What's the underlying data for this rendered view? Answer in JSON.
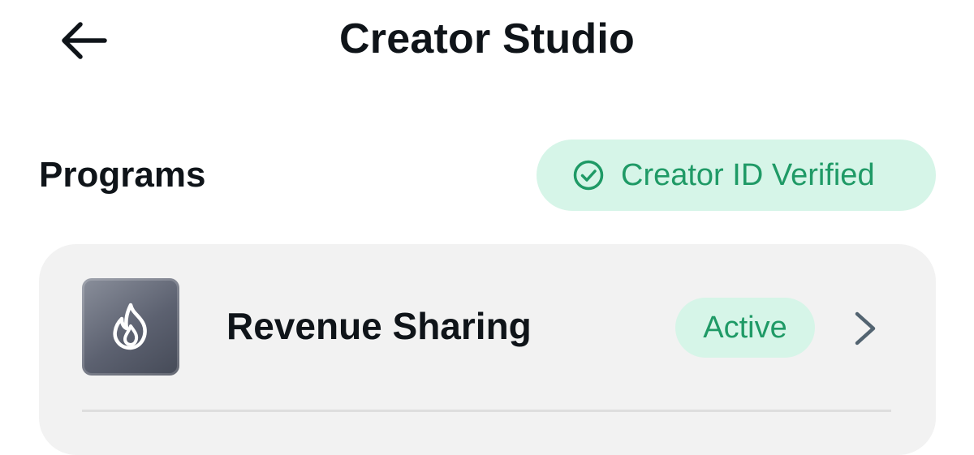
{
  "header": {
    "title": "Creator Studio",
    "back_icon": "arrow-left-icon"
  },
  "programs": {
    "section_title": "Programs",
    "verification": {
      "label": "Creator ID Verified",
      "icon": "check-circle-icon",
      "color": "#1f9a66",
      "background": "#d6f5e8"
    },
    "items": [
      {
        "name": "Revenue Sharing",
        "icon": "flame-icon",
        "status": "Active",
        "chevron_icon": "chevron-right-icon"
      }
    ]
  }
}
